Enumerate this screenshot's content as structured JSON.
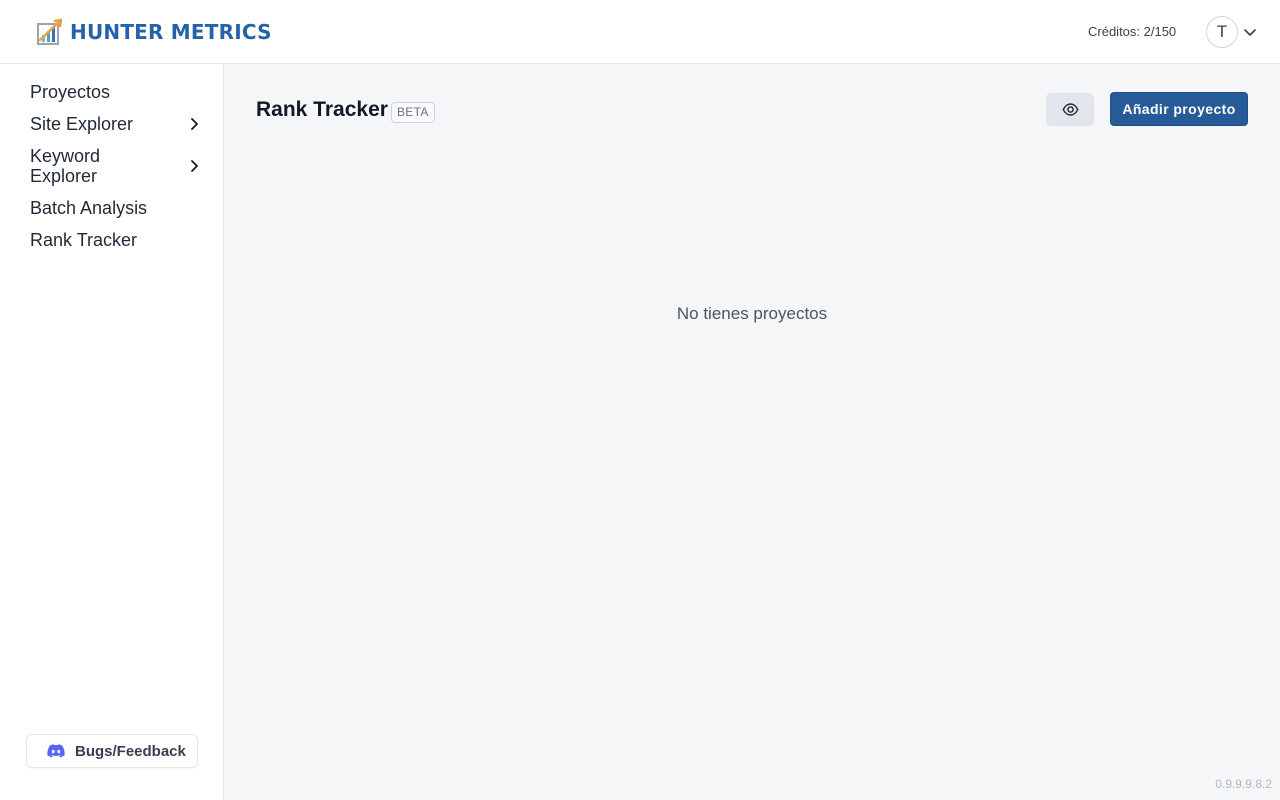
{
  "header": {
    "logo_text": "HUNTER METRICS",
    "credits": "Créditos: 2/150",
    "avatar_initial": "T"
  },
  "sidebar": {
    "items": [
      {
        "label": "Proyectos",
        "has_submenu": false
      },
      {
        "label": "Site Explorer",
        "has_submenu": true
      },
      {
        "label": "Keyword Explorer",
        "has_submenu": true
      },
      {
        "label": "Batch Analysis",
        "has_submenu": false
      },
      {
        "label": "Rank Tracker",
        "has_submenu": false
      }
    ],
    "feedback_label": "Bugs/Feedback"
  },
  "main": {
    "title": "Rank Tracker",
    "badge": "BETA",
    "add_button": "Añadir proyecto",
    "empty_message": "No tienes proyectos",
    "version": "0.9.9.9.8.2"
  },
  "icons": {
    "logo": "chart-logo-icon",
    "avatar_dropdown": "chevron-down-icon",
    "submenu": "chevron-right-icon",
    "feedback": "discord-icon",
    "view": "eye-icon"
  },
  "colors": {
    "brand": "#2563a8",
    "primary_button": "#275b97",
    "main_background": "#f5f6f8",
    "discord": "#5865f2"
  }
}
